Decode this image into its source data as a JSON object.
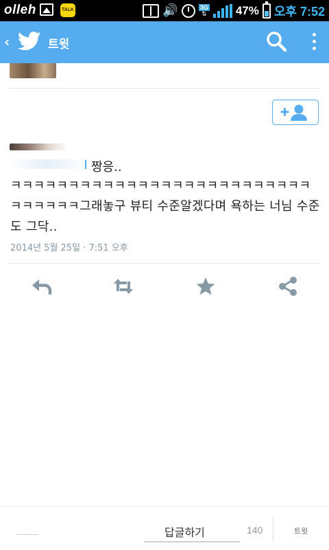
{
  "status_bar": {
    "carrier": "olleh",
    "kakao_badge": "TALK",
    "network": "3G",
    "battery": "47%",
    "time": "오후 7:52",
    "icons": [
      "photo-icon",
      "kakaotalk-icon",
      "screen-mirror-icon",
      "sound-icon",
      "alarm-icon",
      "3g-icon",
      "signal-icon",
      "battery-icon"
    ]
  },
  "action_bar": {
    "back_icon": "chevron-left-icon",
    "logo_icon": "twitter-bird-icon",
    "title": "트윗",
    "search_icon": "search-icon",
    "menu_icon": "overflow-menu-icon",
    "color": "#55acee"
  },
  "tweet": {
    "first_line": "짱응..",
    "body": "ㅋㅋㅋㅋㅋㅋㅋㅋㅋㅋㅋㅋㅋㅋㅋㅋㅋㅋㅋㅋㅋㅋㅋㅋㅋㅋㅋㅋㅋㅋㅋㅋ그래놓구 뷰티 수준알겠다며 욕하는 너님 수준도 그닥..",
    "meta": "2014년 5월 25일 · 7:51 오후",
    "follow_icon": "add-user-icon"
  },
  "actions": [
    {
      "name": "reply-icon"
    },
    {
      "name": "retweet-icon"
    },
    {
      "name": "favorite-icon"
    },
    {
      "name": "share-icon"
    }
  ],
  "compose": {
    "placeholder": "답글하기",
    "count": "140",
    "send_label": "트윗"
  }
}
